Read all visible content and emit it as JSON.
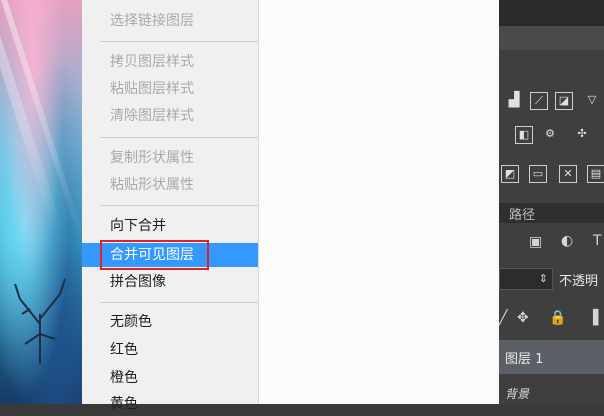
{
  "menu": {
    "items": [
      {
        "label": "选择链接图层",
        "disabled": true
      },
      {
        "label": "拷贝图层样式",
        "disabled": true
      },
      {
        "label": "粘贴图层样式",
        "disabled": true
      },
      {
        "label": "清除图层样式",
        "disabled": true
      },
      {
        "label": "复制形状属性",
        "disabled": true
      },
      {
        "label": "粘贴形状属性",
        "disabled": true
      },
      {
        "label": "向下合并",
        "disabled": false
      },
      {
        "label": "合并可见图层",
        "disabled": false,
        "highlighted": true
      },
      {
        "label": "拼合图像",
        "disabled": false
      },
      {
        "label": "无颜色",
        "disabled": false
      },
      {
        "label": "红色",
        "disabled": false
      },
      {
        "label": "橙色",
        "disabled": false
      },
      {
        "label": "黄色",
        "disabled": false
      }
    ]
  },
  "right_panel": {
    "tab_label": "路径",
    "opacity_label": "不透明",
    "layer_name": "图层 1",
    "background_label": "背景",
    "icons": [
      "levels-icon",
      "curves-icon",
      "exposure-icon",
      "triangle-icon",
      "square-icon",
      "channel-mixer-icon",
      "color-balance-icon",
      "gradient-icon",
      "photo-filter-icon",
      "threshold-icon",
      "image-icon",
      "circle-icon",
      "text-icon",
      "move-icon",
      "lock-icon",
      "brush-icon"
    ]
  },
  "colors": {
    "highlight": "#3399ff",
    "annotation_box": "#e2202a",
    "panel_bg": "#3f3f3f",
    "menu_bg": "#f0f0f0"
  }
}
